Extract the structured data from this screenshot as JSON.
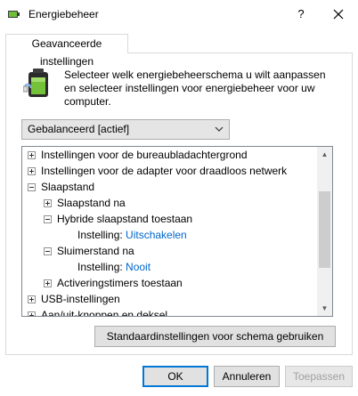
{
  "window": {
    "title": "Energiebeheer",
    "help_label": "?"
  },
  "tab": {
    "label": "Geavanceerde instellingen"
  },
  "description": "Selecteer welk energiebeheerschema u wilt aanpassen en selecteer instellingen voor energiebeheer voor uw computer.",
  "scheme_select": {
    "value": "Gebalanceerd [actief]"
  },
  "tree": {
    "items": [
      {
        "label": "Instellingen voor de bureaubladachtergrond",
        "expander": "plus"
      },
      {
        "label": "Instellingen voor de adapter voor draadloos netwerk",
        "expander": "plus"
      },
      {
        "label": "Slaapstand",
        "expander": "minus"
      },
      {
        "label": "Slaapstand na",
        "expander": "plus"
      },
      {
        "label": "Hybride slaapstand toestaan",
        "expander": "minus"
      },
      {
        "label": "Instelling:",
        "value": "Uitschakelen"
      },
      {
        "label": "Sluimerstand na",
        "expander": "minus"
      },
      {
        "label": "Instelling:",
        "value": "Nooit"
      },
      {
        "label": "Activeringstimers toestaan",
        "expander": "plus"
      },
      {
        "label": "USB-instellingen",
        "expander": "plus"
      },
      {
        "label": "Aan/uit-knoppen en deksel",
        "expander": "plus"
      }
    ]
  },
  "buttons": {
    "restore_defaults": "Standaardinstellingen voor schema gebruiken",
    "ok": "OK",
    "cancel": "Annuleren",
    "apply": "Toepassen"
  },
  "icons": {
    "app": "power-options-icon",
    "battery": "battery-plug-icon",
    "close": "close-icon",
    "dropdown": "chevron-down-icon"
  }
}
